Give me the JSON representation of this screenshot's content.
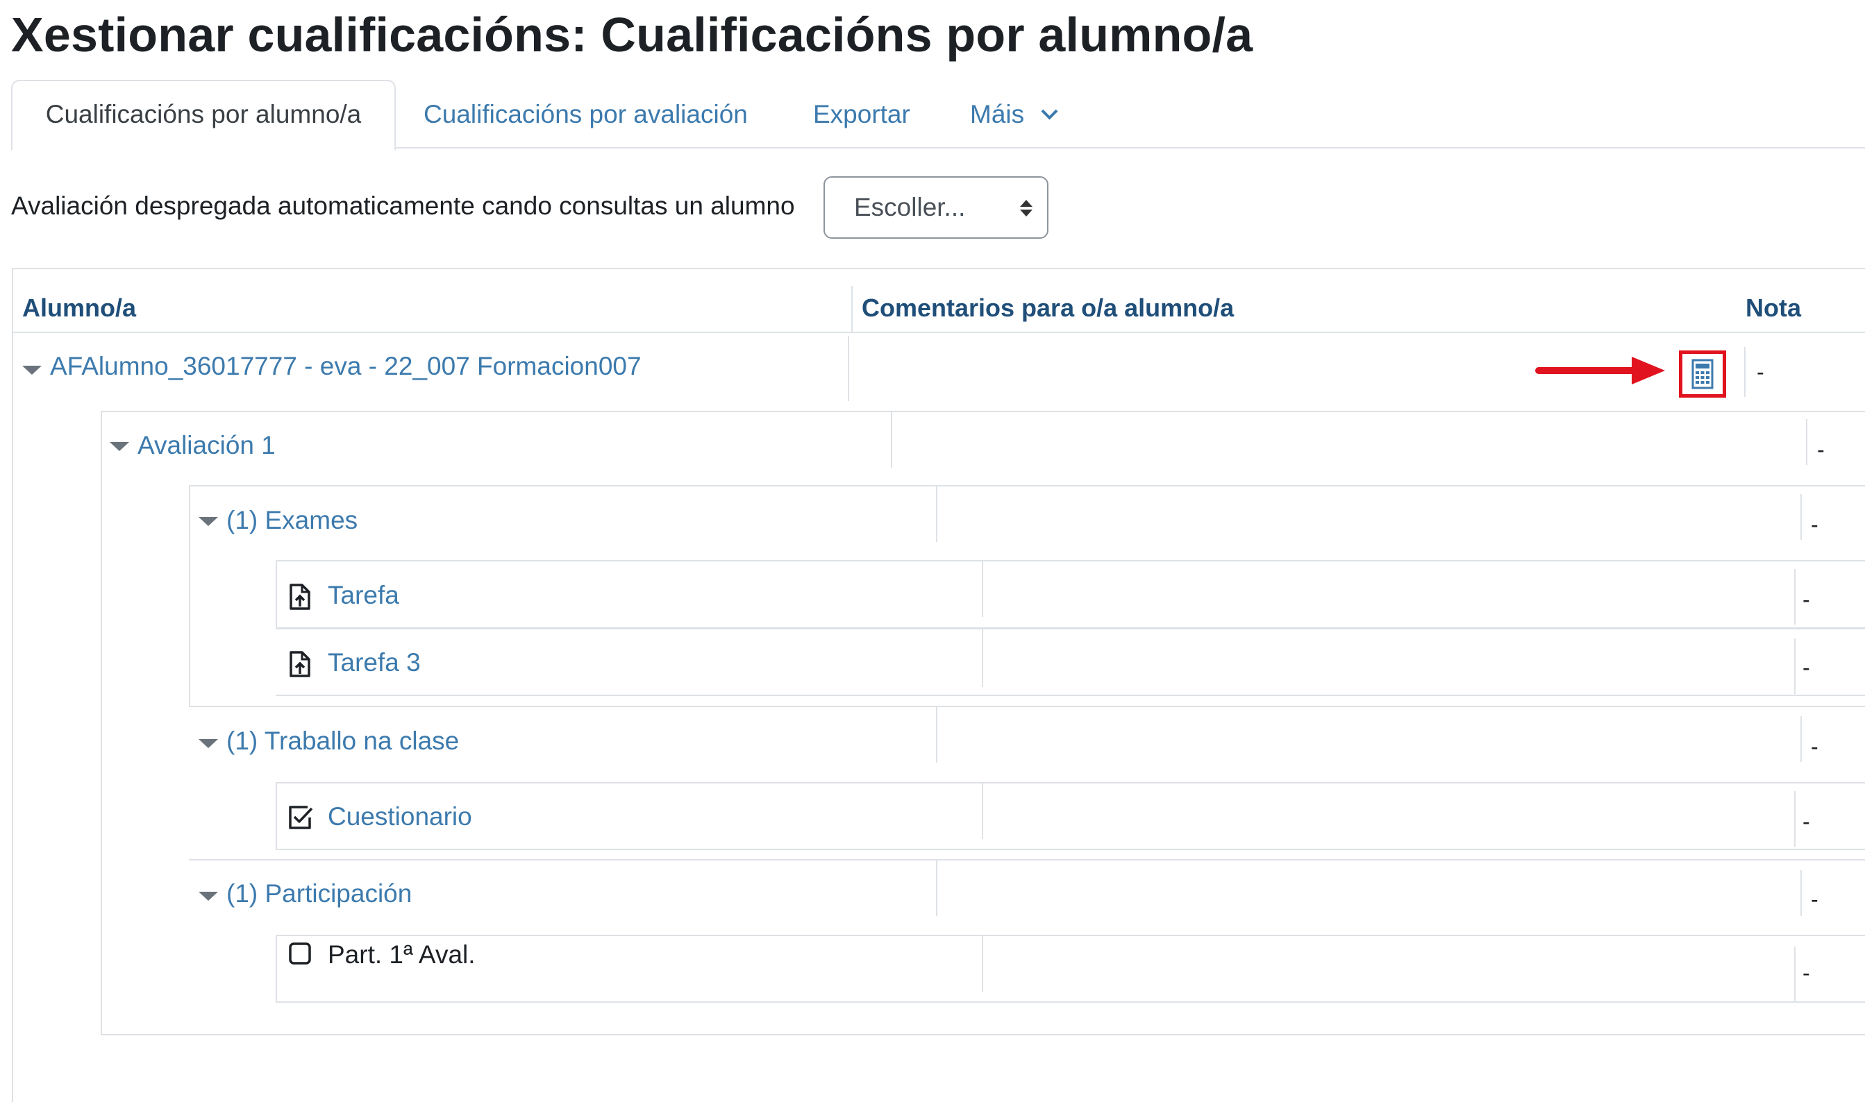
{
  "page": {
    "title": "Xestionar cualificacións: Cualificacións por alumno/a"
  },
  "tabs": [
    {
      "label": "Cualificacións por alumno/a",
      "active": true
    },
    {
      "label": "Cualificacións por avaliación",
      "active": false
    },
    {
      "label": "Exportar",
      "active": false
    },
    {
      "label": "Máis",
      "active": false
    }
  ],
  "filter": {
    "label": "Avaliación despregada automaticamente cando consultas un alumno",
    "select_value": "Escoller..."
  },
  "table": {
    "headers": {
      "student": "Alumno/a",
      "comments": "Comentarios para o/a alumno/a",
      "grade": "Nota"
    },
    "student_row": {
      "name": "AFAlumno_36017777 - eva - 22_007 Formacion007",
      "grade": "-"
    },
    "rows": [
      {
        "label": "Avaliación 1",
        "grade": "-",
        "icon": "caret-down-icon"
      },
      {
        "label": "(1) Exames",
        "grade": "-",
        "icon": "caret-down-icon"
      },
      {
        "label": "Tarefa",
        "grade": "-",
        "icon": "assignment-upload-icon"
      },
      {
        "label": "Tarefa 3",
        "grade": "-",
        "icon": "assignment-upload-icon"
      },
      {
        "label": "(1) Traballo na clase",
        "grade": "-",
        "icon": "caret-down-icon"
      },
      {
        "label": "Cuestionario",
        "grade": "-",
        "icon": "quiz-check-icon"
      },
      {
        "label": "(1) Participación",
        "grade": "-",
        "icon": "caret-down-icon"
      },
      {
        "label": "Part. 1ª Aval.",
        "grade": "-",
        "icon": "checkbox-icon"
      }
    ]
  },
  "colors": {
    "link": "#3c7aad",
    "header": "#1f4e79",
    "highlight": "#e0131f"
  }
}
